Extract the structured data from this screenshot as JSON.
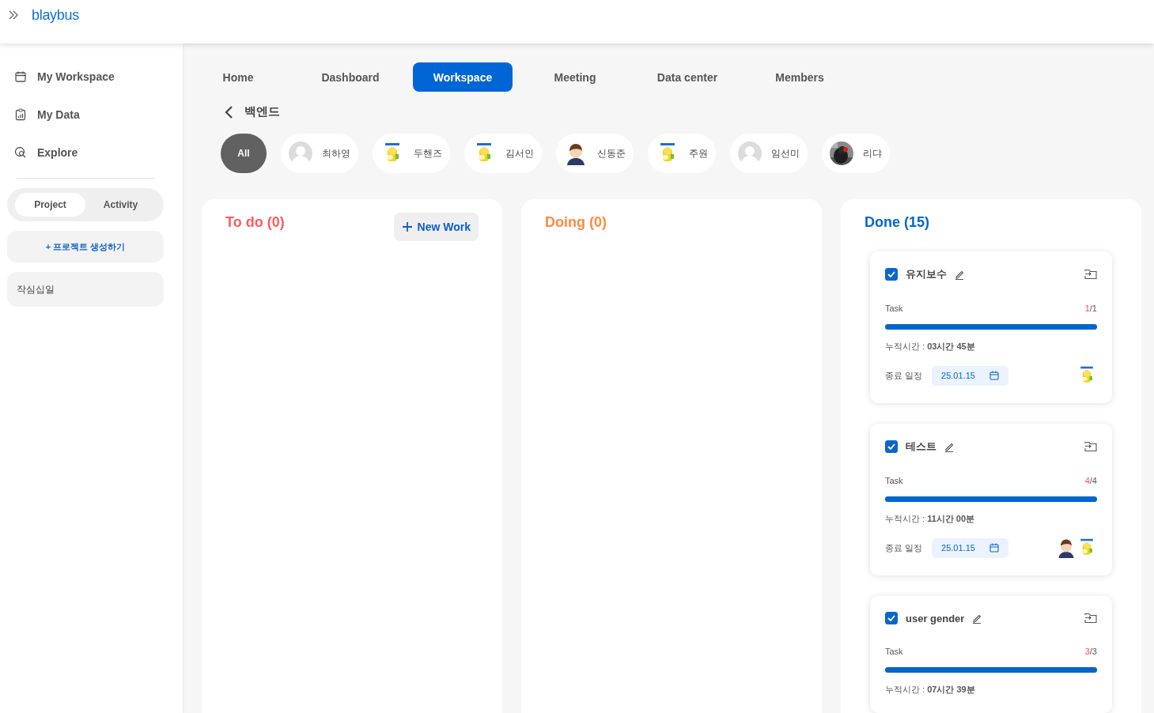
{
  "header": {
    "logo": "blaybus"
  },
  "sidebar": {
    "items": [
      {
        "label": "My Workspace"
      },
      {
        "label": "My Data"
      },
      {
        "label": "Explore"
      }
    ],
    "toggle": [
      {
        "label": "Project",
        "selected": true
      },
      {
        "label": "Activity",
        "selected": false
      }
    ],
    "create_button": "+ 프로젝트 생성하기",
    "projects": [
      {
        "name": "작심십일"
      }
    ]
  },
  "tabs": [
    {
      "label": "Home",
      "selected": false
    },
    {
      "label": "Dashboard",
      "selected": false
    },
    {
      "label": "Workspace",
      "selected": true
    },
    {
      "label": "Meeting",
      "selected": false
    },
    {
      "label": "Data center",
      "selected": false
    },
    {
      "label": "Members",
      "selected": false
    }
  ],
  "project_title": "백엔드",
  "members": [
    {
      "name": "All",
      "kind": "all",
      "selected": true
    },
    {
      "name": "최하영",
      "kind": "blank",
      "selected": false
    },
    {
      "name": "두핸즈",
      "kind": "mascot",
      "selected": false
    },
    {
      "name": "김서인",
      "kind": "mascot",
      "selected": false
    },
    {
      "name": "신동준",
      "kind": "boy",
      "selected": false
    },
    {
      "name": "주원",
      "kind": "mascot",
      "selected": false
    },
    {
      "name": "임선미",
      "kind": "blank",
      "selected": false
    },
    {
      "name": "리댜",
      "selected": false
    }
  ],
  "columns": [
    {
      "title": "To do (0)",
      "color": "#ff5c5c",
      "button": "New Work"
    },
    {
      "title": "Doing (0)",
      "color": "#ff8a3d"
    },
    {
      "title": "Done (15)",
      "color": "#0066cc",
      "cards": [
        {
          "title": "유지보수",
          "checked": true,
          "task_label": "Task",
          "done": "1",
          "total": "/1",
          "level": 1,
          "time": "누적시간 : **03시간 45분**",
          "deadline_label": "종료 일정",
          "deadline": "25.01.15",
          "assignees": [
            {
              "kind": "mascot"
            }
          ]
        },
        {
          "title": "테스트",
          "checked": true,
          "task_label": "Task",
          "done": "4",
          "total": "/4",
          "level": 1,
          "time": "누적시간 : **11시간 00분**",
          "deadline_label": "종료 일정",
          "deadline": "25.01.15",
          "assignees": [
            {
              "kind": "boy"
            },
            {
              "kind": "mascot"
            }
          ]
        },
        {
          "title": "user gender",
          "checked": true,
          "task_label": "Task",
          "done": "3",
          "total": "/3",
          "level": 1,
          "time": "누적시간 : **07시간 39분**"
        }
      ]
    }
  ]
}
